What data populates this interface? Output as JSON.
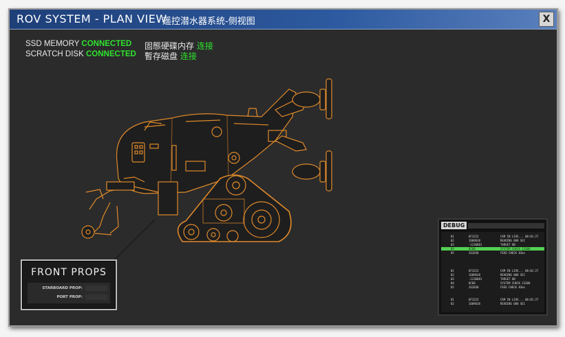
{
  "window": {
    "title_en": "ROV SYSTEM - PLAN VIEW",
    "title_cn": "遥控潜水器系统-侧视图",
    "close_label": "X"
  },
  "status": {
    "ssd_label": "SSD MEMORY",
    "ssd_value": "CONNECTED",
    "scratch_label": "SCRATCH DISK",
    "scratch_value": "CONNECTED",
    "ssd_cn_label": "固態硬碟内存",
    "ssd_cn_value": "连接",
    "scratch_cn_label": "暫存磁盘",
    "scratch_cn_value": "连接"
  },
  "front_props": {
    "title": "FRONT PROPS",
    "starboard_label": "STARBOARD PROP:",
    "port_label": "PORT PROP:"
  },
  "debug": {
    "tab_label": "DEBUG",
    "groups": [
      {
        "rows": [
          {
            "id": "01",
            "code": "6F3223",
            "msg": "CAM IN LIVE... 00:01:27",
            "hl": false
          },
          {
            "id": "02",
            "code": "1609638",
            "msg": "READING 088 SEC",
            "hl": false
          },
          {
            "id": "03",
            "code": "-1236881",
            "msg": "TARGET ON",
            "hl": false
          },
          {
            "id": "04",
            "code": "8C00",
            "msg": "SYSTEM CHECK 23300",
            "hl": true
          },
          {
            "id": "05",
            "code": "262030",
            "msg": "FEED CHECK 83ms",
            "hl": false
          }
        ]
      },
      {
        "rows": [
          {
            "id": "01",
            "code": "6F3223",
            "msg": "CAM IN LIVE... 00:01:27",
            "hl": false
          },
          {
            "id": "02",
            "code": "1609638",
            "msg": "READING 088 SEC",
            "hl": false
          },
          {
            "id": "03",
            "code": "-1236881",
            "msg": "TARGET ON",
            "hl": false
          },
          {
            "id": "04",
            "code": "8C00",
            "msg": "SYSTEM CHECK 23300",
            "hl": false
          },
          {
            "id": "05",
            "code": "262030",
            "msg": "FEED CHECK 83ms",
            "hl": false
          }
        ]
      },
      {
        "rows": [
          {
            "id": "01",
            "code": "6F3223",
            "msg": "CAM IN LIVE... 00:01:27",
            "hl": false
          },
          {
            "id": "02",
            "code": "1609638",
            "msg": "READING 088 SEC",
            "hl": false
          }
        ]
      }
    ]
  },
  "colors": {
    "accent_green": "#2fe12f",
    "wireframe_orange": "#e08a2a",
    "titlebar_blue": "#2d5aa0"
  }
}
